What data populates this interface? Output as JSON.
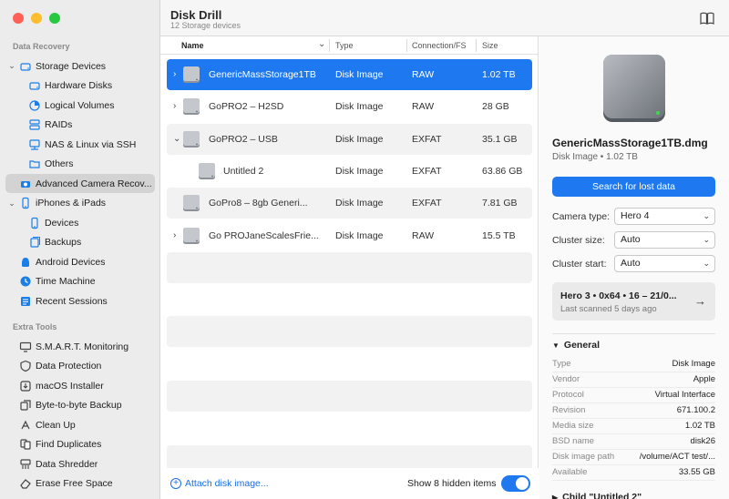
{
  "colors": {
    "accent": "#1e78f0",
    "traffic_red": "#ff5f57",
    "traffic_yellow": "#febc2e",
    "traffic_green": "#28c840",
    "sidebar_icon": "#1a7ee8"
  },
  "sidebar": {
    "section_recovery": "Data Recovery",
    "section_tools": "Extra Tools",
    "recovery_items": [
      {
        "label": "Storage Devices",
        "icon": "hard-drive-icon",
        "chevron": "⌄"
      },
      {
        "label": "Hardware Disks",
        "icon": "hard-drive-icon"
      },
      {
        "label": "Logical Volumes",
        "icon": "pie-icon"
      },
      {
        "label": "RAIDs",
        "icon": "raid-icon"
      },
      {
        "label": "NAS & Linux via SSH",
        "icon": "network-icon"
      },
      {
        "label": "Others",
        "icon": "folder-icon"
      },
      {
        "label": "Advanced Camera Recov...",
        "icon": "camera-icon"
      },
      {
        "label": "iPhones & iPads",
        "icon": "phone-icon",
        "chevron": "⌄"
      },
      {
        "label": "Devices",
        "icon": "phone-icon"
      },
      {
        "label": "Backups",
        "icon": "backup-icon"
      },
      {
        "label": "Android Devices",
        "icon": "android-icon"
      },
      {
        "label": "Time Machine",
        "icon": "clock-icon"
      },
      {
        "label": "Recent Sessions",
        "icon": "list-icon"
      }
    ],
    "tool_items": [
      {
        "label": "S.M.A.R.T. Monitoring",
        "icon": "monitor-icon"
      },
      {
        "label": "Data Protection",
        "icon": "shield-icon"
      },
      {
        "label": "macOS Installer",
        "icon": "installer-icon"
      },
      {
        "label": "Byte-to-byte Backup",
        "icon": "copy-icon"
      },
      {
        "label": "Clean Up",
        "icon": "cleanup-icon"
      },
      {
        "label": "Find Duplicates",
        "icon": "duplicate-icon"
      },
      {
        "label": "Data Shredder",
        "icon": "shredder-icon"
      },
      {
        "label": "Erase Free Space",
        "icon": "eraser-icon"
      }
    ]
  },
  "header": {
    "title": "Disk Drill",
    "subtitle": "12 Storage devices"
  },
  "table": {
    "columns": {
      "name": "Name",
      "type": "Type",
      "fs": "Connection/FS",
      "size": "Size"
    },
    "rows": [
      {
        "expander": "›",
        "name": "GenericMassStorage1TB",
        "type": "Disk Image",
        "fs": "RAW",
        "size": "1.02 TB"
      },
      {
        "expander": "›",
        "name": "GoPRO2 – H2SD",
        "type": "Disk Image",
        "fs": "RAW",
        "size": "28 GB"
      },
      {
        "expander": "⌄",
        "name": "GoPRO2 – USB",
        "type": "Disk Image",
        "fs": "EXFAT",
        "size": "35.1 GB"
      },
      {
        "expander": "",
        "name": "Untitled 2",
        "type": "Disk Image",
        "fs": "EXFAT",
        "size": "63.86 GB"
      },
      {
        "expander": "",
        "name": "GoPro8 – 8gb Generi...",
        "type": "Disk Image",
        "fs": "EXFAT",
        "size": "7.81 GB"
      },
      {
        "expander": "›",
        "name": "Go PROJaneScalesFrie...",
        "type": "Disk Image",
        "fs": "RAW",
        "size": "15.5 TB"
      }
    ]
  },
  "footer": {
    "attach_label": "Attach disk image...",
    "hidden_label": "Show 8 hidden items",
    "hidden_toggle_on": true
  },
  "panel": {
    "name": "GenericMassStorage1TB.dmg",
    "subtitle": "Disk Image • 1.02 TB",
    "search_button": "Search for lost data",
    "camera_label": "Camera type:",
    "camera_value": "Hero 4",
    "cluster_size_label": "Cluster size:",
    "cluster_size_value": "Auto",
    "cluster_start_label": "Cluster start:",
    "cluster_start_value": "Auto",
    "session_title": "Hero 3 • 0x64 • 16 – 21/0...",
    "session_sub": "Last scanned 5 days ago",
    "general_header": "General",
    "general": [
      {
        "k": "Type",
        "v": "Disk Image"
      },
      {
        "k": "Vendor",
        "v": "Apple"
      },
      {
        "k": "Protocol",
        "v": "Virtual Interface"
      },
      {
        "k": "Revision",
        "v": "671.100.2"
      },
      {
        "k": "Media size",
        "v": "1.02 TB"
      },
      {
        "k": "BSD name",
        "v": "disk26"
      },
      {
        "k": "Disk image path",
        "v": "/volume/ACT test/..."
      },
      {
        "k": "Available",
        "v": "33.55 GB"
      }
    ],
    "child_header": "Child \"Untitled 2\""
  }
}
